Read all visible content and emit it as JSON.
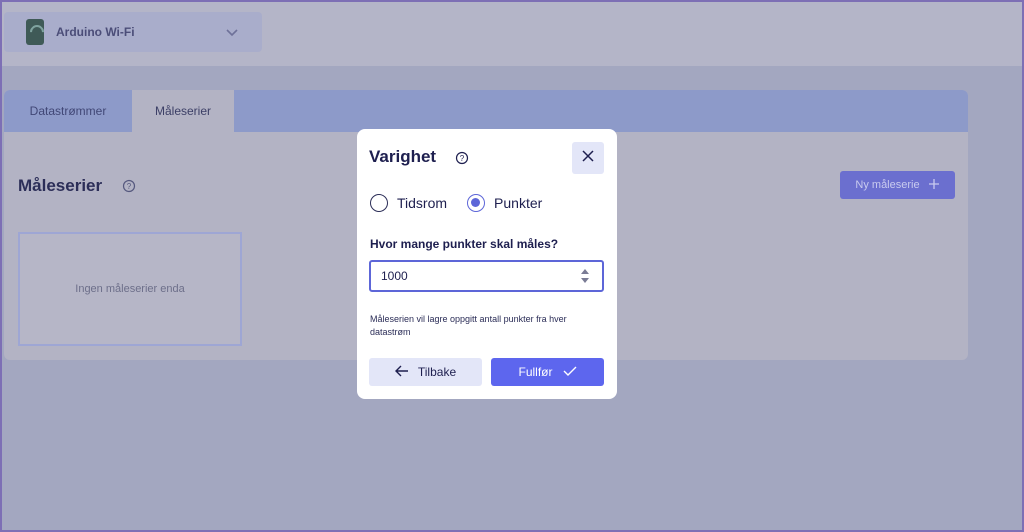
{
  "header": {
    "device_name": "Arduino Wi-Fi",
    "device_icon": "arduino-device-icon",
    "dropdown_icon": "chevron-down-icon"
  },
  "tabs": [
    {
      "label": "Datastrømmer",
      "active": false
    },
    {
      "label": "Måleserier",
      "active": true
    }
  ],
  "main": {
    "title": "Måleserier",
    "help_icon": "help-circle-icon",
    "new_button_label": "Ny måleserie",
    "new_button_icon": "plus-icon",
    "empty_text": "Ingen måleserier enda"
  },
  "modal": {
    "title": "Varighet",
    "help_icon": "help-circle-icon",
    "close_icon": "close-icon",
    "options": [
      {
        "label": "Tidsrom",
        "selected": false
      },
      {
        "label": "Punkter",
        "selected": true
      }
    ],
    "field_label": "Hvor mange punkter skal måles?",
    "field_value": "1000",
    "helper_text": "Måleserien vil lagre oppgitt antall punkter fra hver datastrøm",
    "back_label": "Tilbake",
    "back_icon": "arrow-left-icon",
    "finish_label": "Fullfør",
    "finish_icon": "checkmark-icon"
  },
  "colors": {
    "accent": "#5d66ee",
    "title": "#1e1f4f",
    "overlay": "#a3a7c0"
  }
}
